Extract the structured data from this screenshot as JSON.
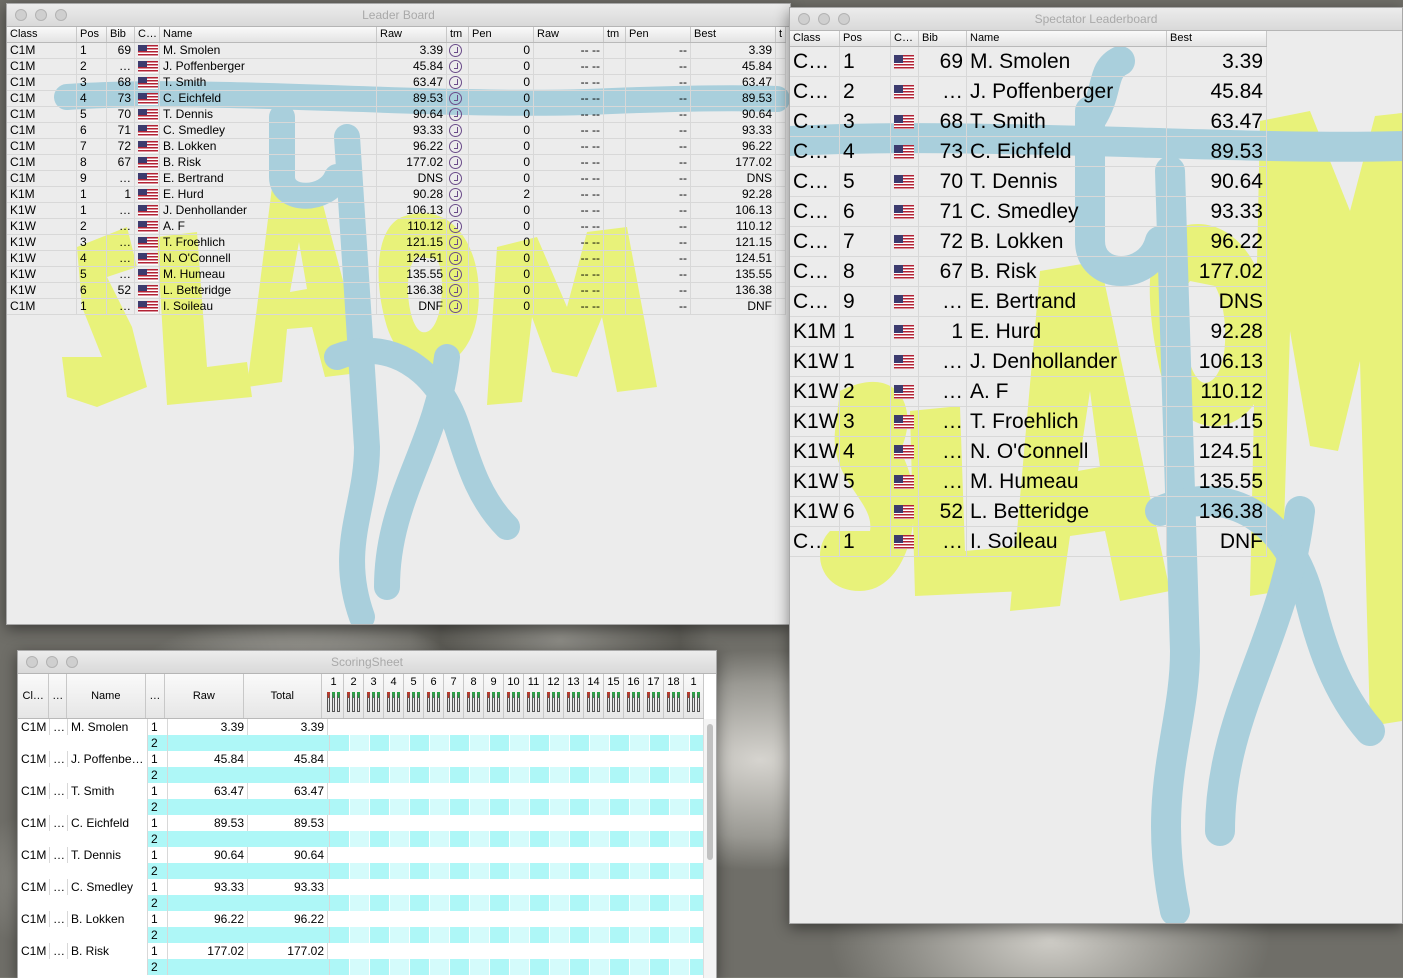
{
  "desktop": {
    "name": "pebble desktop background"
  },
  "leader_board": {
    "title": "Leader Board",
    "columns": [
      "Class",
      "Pos",
      "Bib",
      "C…",
      "Name",
      "Raw",
      "tm",
      "Pen",
      "Raw",
      "tm",
      "Pen",
      "Best",
      "t"
    ],
    "rows": [
      {
        "cls": "C1M",
        "pos": "1",
        "bib": "69",
        "name": "M. Smolen",
        "raw": "3.39",
        "pen": "0",
        "raw2": "-- --",
        "pen2": "--",
        "best": "3.39"
      },
      {
        "cls": "C1M",
        "pos": "2",
        "bib": "…",
        "name": "J. Poffenberger",
        "raw": "45.84",
        "pen": "0",
        "raw2": "-- --",
        "pen2": "--",
        "best": "45.84"
      },
      {
        "cls": "C1M",
        "pos": "3",
        "bib": "68",
        "name": "T. Smith",
        "raw": "63.47",
        "pen": "0",
        "raw2": "-- --",
        "pen2": "--",
        "best": "63.47"
      },
      {
        "cls": "C1M",
        "pos": "4",
        "bib": "73",
        "name": "C. Eichfeld",
        "raw": "89.53",
        "pen": "0",
        "raw2": "-- --",
        "pen2": "--",
        "best": "89.53"
      },
      {
        "cls": "C1M",
        "pos": "5",
        "bib": "70",
        "name": "T. Dennis",
        "raw": "90.64",
        "pen": "0",
        "raw2": "-- --",
        "pen2": "--",
        "best": "90.64"
      },
      {
        "cls": "C1M",
        "pos": "6",
        "bib": "71",
        "name": "C. Smedley",
        "raw": "93.33",
        "pen": "0",
        "raw2": "-- --",
        "pen2": "--",
        "best": "93.33"
      },
      {
        "cls": "C1M",
        "pos": "7",
        "bib": "72",
        "name": "B. Lokken",
        "raw": "96.22",
        "pen": "0",
        "raw2": "-- --",
        "pen2": "--",
        "best": "96.22"
      },
      {
        "cls": "C1M",
        "pos": "8",
        "bib": "67",
        "name": "B. Risk",
        "raw": "177.02",
        "pen": "0",
        "raw2": "-- --",
        "pen2": "--",
        "best": "177.02"
      },
      {
        "cls": "C1M",
        "pos": "9",
        "bib": "…",
        "name": "E. Bertrand",
        "raw": "DNS",
        "pen": "0",
        "raw2": "-- --",
        "pen2": "--",
        "best": "DNS"
      },
      {
        "cls": "K1M",
        "pos": "1",
        "bib": "1",
        "name": "E. Hurd",
        "raw": "90.28",
        "pen": "2",
        "raw2": "-- --",
        "pen2": "--",
        "best": "92.28"
      },
      {
        "cls": "K1W",
        "pos": "1",
        "bib": "…",
        "name": "J. Denhollander",
        "raw": "106.13",
        "pen": "0",
        "raw2": "-- --",
        "pen2": "--",
        "best": "106.13"
      },
      {
        "cls": "K1W",
        "pos": "2",
        "bib": "…",
        "name": "A. F",
        "raw": "110.12",
        "pen": "0",
        "raw2": "-- --",
        "pen2": "--",
        "best": "110.12"
      },
      {
        "cls": "K1W",
        "pos": "3",
        "bib": "…",
        "name": "T. Froehlich",
        "raw": "121.15",
        "pen": "0",
        "raw2": "-- --",
        "pen2": "--",
        "best": "121.15"
      },
      {
        "cls": "K1W",
        "pos": "4",
        "bib": "…",
        "name": "N. O'Connell",
        "raw": "124.51",
        "pen": "0",
        "raw2": "-- --",
        "pen2": "--",
        "best": "124.51"
      },
      {
        "cls": "K1W",
        "pos": "5",
        "bib": "…",
        "name": "M. Humeau",
        "raw": "135.55",
        "pen": "0",
        "raw2": "-- --",
        "pen2": "--",
        "best": "135.55"
      },
      {
        "cls": "K1W",
        "pos": "6",
        "bib": "52",
        "name": "L. Betteridge",
        "raw": "136.38",
        "pen": "0",
        "raw2": "-- --",
        "pen2": "--",
        "best": "136.38"
      },
      {
        "cls": "C1M",
        "pos": "1",
        "bib": "…",
        "name": "I. Soileau",
        "raw": "DNF",
        "pen": "0",
        "raw2": "-- --",
        "pen2": "--",
        "best": "DNF"
      }
    ]
  },
  "spectator": {
    "title": "Spectator Leaderboard",
    "columns": [
      "Class",
      "Pos",
      "C…",
      "Bib",
      "Name",
      "Best"
    ],
    "rows": [
      {
        "cls": "C…",
        "pos": "1",
        "bib": "69",
        "name": "M. Smolen",
        "best": "3.39"
      },
      {
        "cls": "C…",
        "pos": "2",
        "bib": "…",
        "name": "J. Poffenberger",
        "best": "45.84"
      },
      {
        "cls": "C…",
        "pos": "3",
        "bib": "68",
        "name": "T. Smith",
        "best": "63.47"
      },
      {
        "cls": "C…",
        "pos": "4",
        "bib": "73",
        "name": "C. Eichfeld",
        "best": "89.53"
      },
      {
        "cls": "C…",
        "pos": "5",
        "bib": "70",
        "name": "T. Dennis",
        "best": "90.64"
      },
      {
        "cls": "C…",
        "pos": "6",
        "bib": "71",
        "name": "C. Smedley",
        "best": "93.33"
      },
      {
        "cls": "C…",
        "pos": "7",
        "bib": "72",
        "name": "B. Lokken",
        "best": "96.22"
      },
      {
        "cls": "C…",
        "pos": "8",
        "bib": "67",
        "name": "B. Risk",
        "best": "177.02"
      },
      {
        "cls": "C…",
        "pos": "9",
        "bib": "…",
        "name": "E. Bertrand",
        "best": "DNS"
      },
      {
        "cls": "K1M",
        "pos": "1",
        "bib": "1",
        "name": "E. Hurd",
        "best": "92.28"
      },
      {
        "cls": "K1W",
        "pos": "1",
        "bib": "…",
        "name": "J. Denhollander",
        "best": "106.13"
      },
      {
        "cls": "K1W",
        "pos": "2",
        "bib": "…",
        "name": "A. F",
        "best": "110.12"
      },
      {
        "cls": "K1W",
        "pos": "3",
        "bib": "…",
        "name": "T. Froehlich",
        "best": "121.15"
      },
      {
        "cls": "K1W",
        "pos": "4",
        "bib": "…",
        "name": "N. O'Connell",
        "best": "124.51"
      },
      {
        "cls": "K1W",
        "pos": "5",
        "bib": "…",
        "name": "M. Humeau",
        "best": "135.55"
      },
      {
        "cls": "K1W",
        "pos": "6",
        "bib": "52",
        "name": "L. Betteridge",
        "best": "136.38"
      },
      {
        "cls": "C…",
        "pos": "1",
        "bib": "…",
        "name": "I. Soileau",
        "best": "DNF"
      }
    ]
  },
  "scoring": {
    "title": "ScoringSheet",
    "columns": [
      "Cl…",
      "…",
      "Name",
      "…",
      "Raw",
      "Total"
    ],
    "gates": [
      "1",
      "2",
      "3",
      "4",
      "5",
      "6",
      "7",
      "8",
      "9",
      "10",
      "11",
      "12",
      "13",
      "14",
      "15",
      "16",
      "17",
      "18",
      "1"
    ],
    "rows": [
      {
        "cls": "C1M",
        "d": "…",
        "name": "M. Smolen",
        "raw": "3.39",
        "total": "3.39"
      },
      {
        "cls": "C1M",
        "d": "…",
        "name": "J. Poffenbe…",
        "raw": "45.84",
        "total": "45.84"
      },
      {
        "cls": "C1M",
        "d": "…",
        "name": "T. Smith",
        "raw": "63.47",
        "total": "63.47"
      },
      {
        "cls": "C1M",
        "d": "…",
        "name": "C. Eichfeld",
        "raw": "89.53",
        "total": "89.53"
      },
      {
        "cls": "C1M",
        "d": "…",
        "name": "T. Dennis",
        "raw": "90.64",
        "total": "90.64"
      },
      {
        "cls": "C1M",
        "d": "…",
        "name": "C. Smedley",
        "raw": "93.33",
        "total": "93.33"
      },
      {
        "cls": "C1M",
        "d": "…",
        "name": "B. Lokken",
        "raw": "96.22",
        "total": "96.22"
      },
      {
        "cls": "C1M",
        "d": "…",
        "name": "B. Risk",
        "raw": "177.02",
        "total": "177.02"
      }
    ],
    "run1": "1",
    "run2": "2"
  },
  "watermark": {
    "text": "SLALOM",
    "yellow": "#e8f27a",
    "blue": "#a9cfdc"
  },
  "colors": {
    "row_cyan": "#aef7f7",
    "row_cyan_light": "#d4fbfb",
    "gate_red": "#c0392b",
    "gate_green": "#27a844"
  }
}
